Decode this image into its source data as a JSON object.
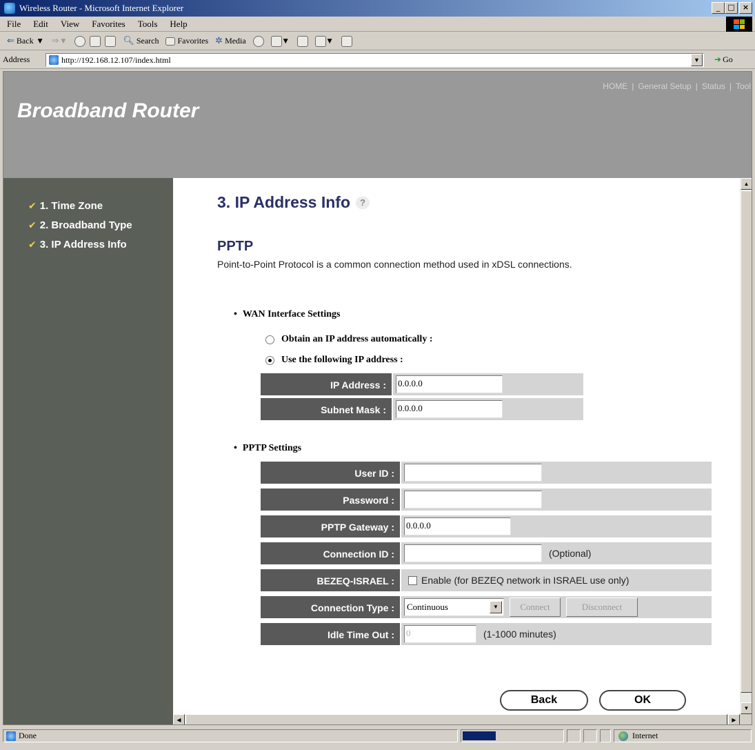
{
  "window": {
    "title": "Wireless Router - Microsoft Internet Explorer",
    "min": "_",
    "max": "□",
    "close": "×"
  },
  "menu": [
    "File",
    "Edit",
    "View",
    "Favorites",
    "Tools",
    "Help"
  ],
  "toolbar": {
    "back": "Back",
    "search": "Search",
    "favorites": "Favorites",
    "media": "Media"
  },
  "address": {
    "label": "Address",
    "url": "http://192.168.12.107/index.html",
    "go": "Go"
  },
  "banner": {
    "brand": "Broadband Router",
    "nav": [
      "HOME",
      "General Setup",
      "Status",
      "Tool"
    ],
    "sep": "|"
  },
  "sidebar": {
    "items": [
      "1. Time Zone",
      "2. Broadband Type",
      "3. IP Address Info"
    ]
  },
  "page": {
    "title": "3. IP Address Info",
    "help_glyph": "?",
    "subtitle": "PPTP",
    "description": "Point-to-Point Protocol is a common connection method used in xDSL connections."
  },
  "wan": {
    "heading": "WAN Interface Settings",
    "auto_label": "Obtain an IP address automatically :",
    "manual_label": "Use the following IP address :",
    "selected": "manual",
    "ip_label": "IP Address :",
    "ip_value": "0.0.0.0",
    "mask_label": "Subnet Mask :",
    "mask_value": "0.0.0.0"
  },
  "pptp": {
    "heading": "PPTP Settings",
    "user_label": "User ID :",
    "user_value": "",
    "pass_label": "Password :",
    "pass_value": "",
    "gateway_label": "PPTP Gateway :",
    "gateway_value": "0.0.0.0",
    "connid_label": "Connection ID :",
    "connid_value": "",
    "connid_hint": "(Optional)",
    "bezeq_label": "BEZEQ-ISRAEL :",
    "bezeq_text": "Enable (for BEZEQ network in ISRAEL use only)",
    "bezeq_checked": false,
    "conntype_label": "Connection Type :",
    "conntype_value": "Continuous",
    "connect_label": "Connect",
    "disconnect_label": "Disconnect",
    "idle_label": "Idle Time Out :",
    "idle_value": "0",
    "idle_hint": "(1-1000 minutes)"
  },
  "buttons": {
    "back": "Back",
    "ok": "OK"
  },
  "status": {
    "text": "Done",
    "progress": 0.33,
    "zone": "Internet"
  },
  "colors": {
    "banner": "#999999",
    "sidebar": "#5a5f58",
    "label_bg": "#595959",
    "cell_bg": "#d4d4d4",
    "heading": "#2a2f66",
    "check": "#e8d24a"
  }
}
